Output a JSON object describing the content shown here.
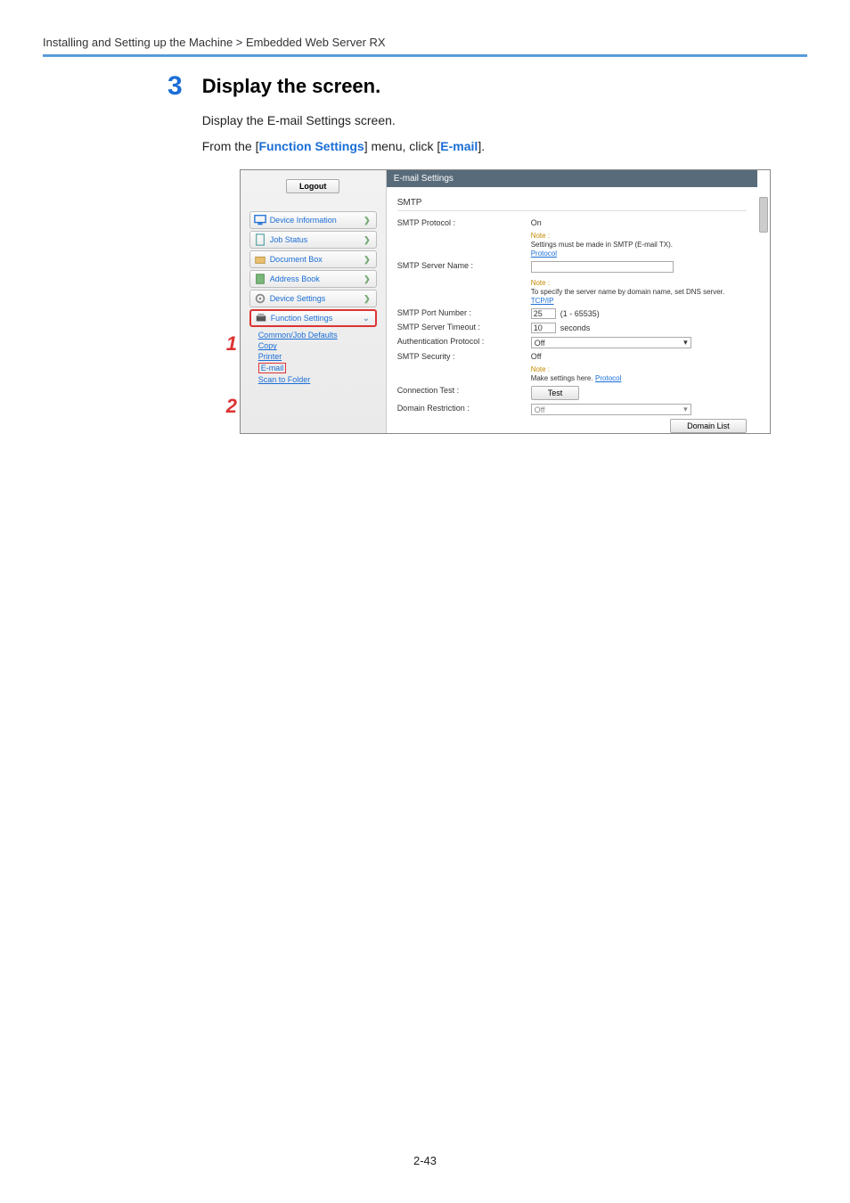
{
  "breadcrumb": "Installing and Setting up the Machine > Embedded Web Server RX",
  "step": {
    "num": "3",
    "title": "Display the screen."
  },
  "desc1": "Display the E-mail Settings screen.",
  "desc2_pre": "From the [",
  "desc2_link1": "Function Settings",
  "desc2_mid": "] menu, click [",
  "desc2_link2": "E-mail",
  "desc2_post": "].",
  "logout": "Logout",
  "nav": {
    "devinfo": "Device Information",
    "jobstatus": "Job Status",
    "docbox": "Document Box",
    "addrbook": "Address Book",
    "devset": "Device Settings",
    "funcset": "Function Settings"
  },
  "sub": {
    "common": "Common/Job Defaults",
    "copy": "Copy",
    "printer": "Printer",
    "email": "E-mail",
    "scan": "Scan to Folder"
  },
  "callout1": "1",
  "callout2": "2",
  "es": {
    "title": "E-mail Settings",
    "smtp": "SMTP",
    "proto_l": "SMTP Protocol :",
    "proto_v": "On",
    "note1a": "Note :",
    "note1b": "Settings must be made in SMTP (E-mail TX).",
    "protocol_link": "Protocol",
    "server_l": "SMTP Server Name :",
    "note2a": "Note :",
    "note2b": "To specify the server name by domain name, set DNS server.",
    "tcpip": "TCP/IP",
    "port_l": "SMTP Port Number :",
    "port_v": "25",
    "port_hint": "(1 - 65535)",
    "timeout_l": "SMTP Server Timeout :",
    "timeout_v": "10",
    "timeout_unit": "seconds",
    "auth_l": "Authentication Protocol :",
    "auth_v": "Off",
    "sec_l": "SMTP Security :",
    "sec_v": "Off",
    "note3a": "Note :",
    "note3b": "Make settings here.",
    "conn_l": "Connection Test :",
    "conn_btn": "Test",
    "dom_l": "Domain Restriction :",
    "dom_v": "Off",
    "domlist": "Domain List"
  },
  "pagenum": "2-43"
}
